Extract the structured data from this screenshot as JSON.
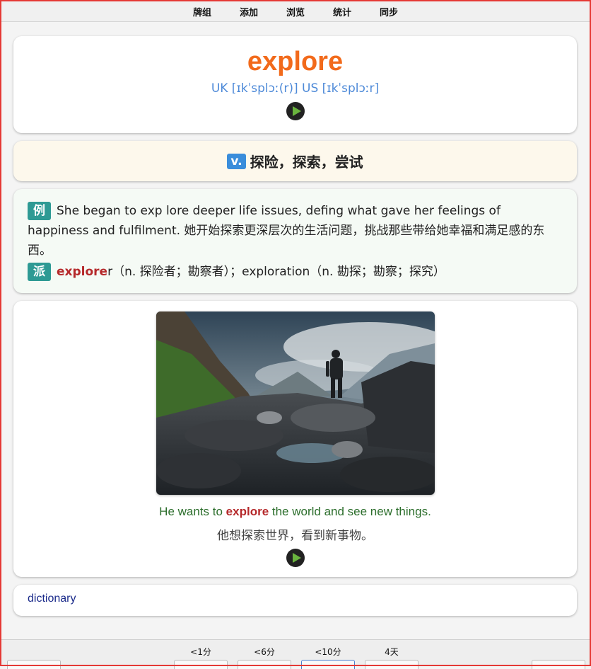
{
  "topnav": {
    "items": [
      "牌组",
      "添加",
      "浏览",
      "统计",
      "同步"
    ]
  },
  "word": {
    "text": "explore",
    "phonetic": "UK [ɪkˈsplɔː(r)] US [ɪkˈsplɔːr]"
  },
  "definition": {
    "pos": "v.",
    "meaning": "探险，探索，尝试"
  },
  "example": {
    "tag": "例",
    "text": "She began to exp lore deeper life issues, defing what gave her feelings of happiness and fulfilment. 她开始探索更深层次的生活问题，挑战那些带给她幸福和满足感的东西。"
  },
  "derivation": {
    "tag": "派",
    "highlight": "explore",
    "rest": "r（n. 探险者；勘察者）；exploration（n. 勘探；勘察；探究）"
  },
  "image_sentence": {
    "en_before": "He wants to ",
    "en_highlight": "explore",
    "en_after": " the world and see new things.",
    "zh": "他想探索世界，看到新事物。"
  },
  "dictionary": {
    "label": "dictionary"
  },
  "bottombar": {
    "intervals": [
      "<1分",
      "<6分",
      "<10分",
      "4天"
    ]
  },
  "colors": {
    "word": "#f26a1b",
    "phonetic": "#4e8ad8",
    "pos_badge": "#3a8ddb",
    "tag": "#2e9a94",
    "highlight": "#b5282a",
    "sentence_en": "#2c6e2c",
    "play_icon": "#6ab43e",
    "frame": "#e53935"
  }
}
